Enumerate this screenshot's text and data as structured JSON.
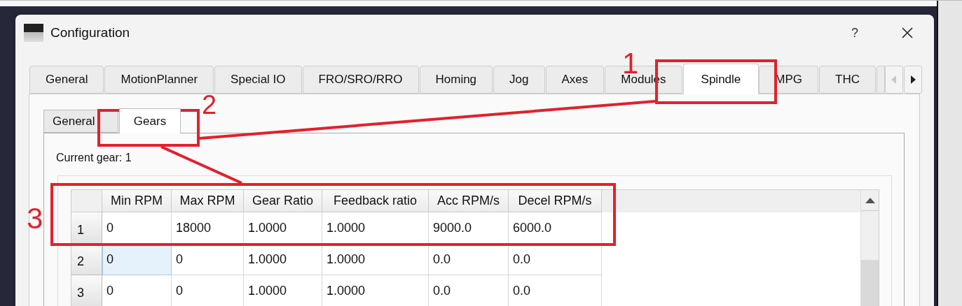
{
  "window": {
    "title": "Configuration",
    "help": "?"
  },
  "tabs": [
    {
      "label": "General",
      "selected": false
    },
    {
      "label": "MotionPlanner",
      "selected": false
    },
    {
      "label": "Special IO",
      "selected": false
    },
    {
      "label": "FRO/SRO/RRO",
      "selected": false
    },
    {
      "label": "Homing",
      "selected": false
    },
    {
      "label": "Jog",
      "selected": false
    },
    {
      "label": "Axes",
      "selected": false
    },
    {
      "label": "Modules",
      "selected": false
    },
    {
      "label": "Spindle",
      "selected": true
    },
    {
      "label": "MPG",
      "selected": false
    },
    {
      "label": "THC",
      "selected": false
    }
  ],
  "tab_scroll": {
    "left_disabled": true,
    "right_disabled": false
  },
  "subtabs": [
    {
      "label": "General",
      "selected": false
    },
    {
      "label": "Gears",
      "selected": true
    }
  ],
  "current_gear": "Current gear: 1",
  "table": {
    "columns": [
      "Min RPM",
      "Max RPM",
      "Gear Ratio",
      "Feedback ratio",
      "Acc RPM/s",
      "Decel RPM/s"
    ],
    "rows": [
      {
        "header": "1",
        "cells": [
          {
            "text": "0",
            "selected": false
          },
          {
            "text": "18000",
            "selected": false
          },
          {
            "text": "1.0000",
            "selected": false
          },
          {
            "text": "1.0000",
            "selected": false
          },
          {
            "text": "9000.0",
            "selected": false
          },
          {
            "text": "6000.0",
            "selected": false
          }
        ]
      },
      {
        "header": "2",
        "cells": [
          {
            "text": "0",
            "selected": true
          },
          {
            "text": "0",
            "selected": false
          },
          {
            "text": "1.0000",
            "selected": false
          },
          {
            "text": "1.0000",
            "selected": false
          },
          {
            "text": "0.0",
            "selected": false
          },
          {
            "text": "0.0",
            "selected": false
          }
        ]
      },
      {
        "header": "3",
        "cells": [
          {
            "text": "0",
            "selected": false
          },
          {
            "text": "0",
            "selected": false
          },
          {
            "text": "1.0000",
            "selected": false
          },
          {
            "text": "1.0000",
            "selected": false
          },
          {
            "text": "0.0",
            "selected": false
          },
          {
            "text": "0.0",
            "selected": false
          }
        ]
      }
    ]
  },
  "annotations": [
    {
      "label": "1"
    },
    {
      "label": "2"
    },
    {
      "label": "3"
    }
  ]
}
